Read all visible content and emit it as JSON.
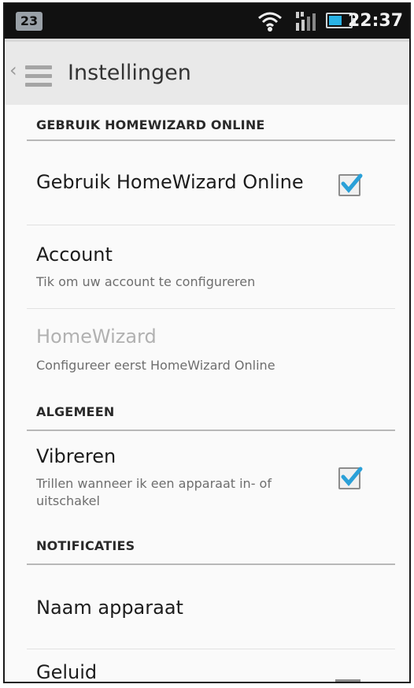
{
  "status_bar": {
    "notification": "23",
    "time": "22:37",
    "icons": [
      "wifi-icon",
      "signal-icon",
      "battery-icon"
    ]
  },
  "action_bar": {
    "title": "Instellingen",
    "icons": [
      "back-chevron-icon",
      "menu-icon"
    ]
  },
  "sections": {
    "online": {
      "header": "GEBRUIK HOMEWIZARD ONLINE",
      "use_online": {
        "title": "Gebruik HomeWizard Online",
        "checked": true
      },
      "account": {
        "title": "Account",
        "summary": "Tik om uw account te configureren"
      },
      "homewizard": {
        "title": "HomeWizard",
        "summary": "Configureer eerst HomeWizard Online",
        "enabled": false
      }
    },
    "general": {
      "header": "ALGEMEEN",
      "vibrate": {
        "title": "Vibreren",
        "summary": "Trillen wanneer ik een apparaat in- of uitschakel",
        "checked": true
      }
    },
    "notifications": {
      "header": "NOTIFICATIES",
      "device_name": {
        "title": "Naam apparaat"
      },
      "sound": {
        "title": "Geluid"
      }
    }
  },
  "colors": {
    "accent": "#29b3e6",
    "checkmark": "#2aa0d8",
    "status_bar": "#111111"
  }
}
